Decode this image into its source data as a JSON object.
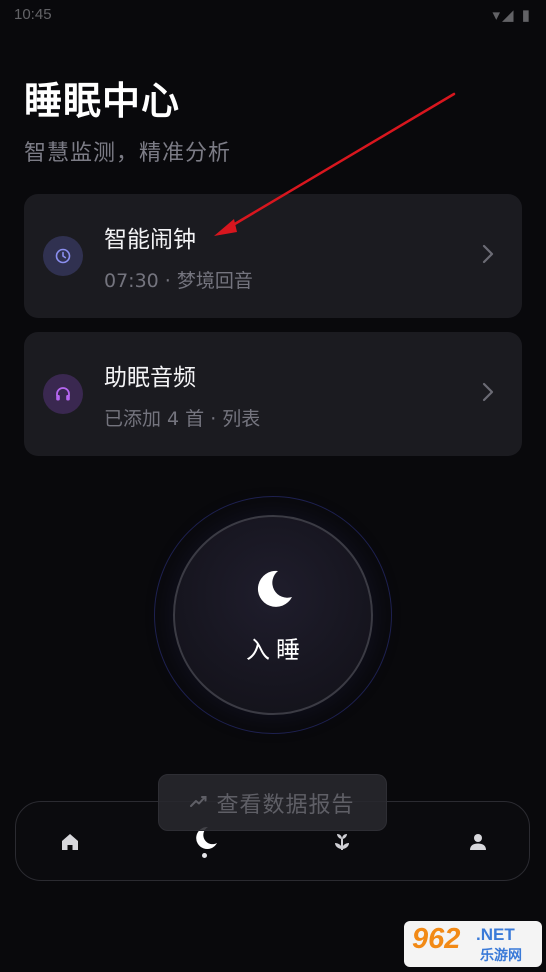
{
  "status_bar": {
    "time": "10:45",
    "right": "▾◢ ▮"
  },
  "header": {
    "title": "睡眠中心",
    "subtitle": "智慧监测，精准分析"
  },
  "cards": [
    {
      "title": "智能闹钟",
      "subtitle": "07:30 · 梦境回音",
      "icon": "clock-icon",
      "accent": "#8b8ff0"
    },
    {
      "title": "助眠音频",
      "subtitle": "已添加 4 首 · 列表",
      "icon": "headphones-icon",
      "accent": "#b566f0"
    }
  ],
  "sleep_button": {
    "label": "入睡",
    "icon": "moon-icon"
  },
  "report_button": {
    "label": "查看数据报告",
    "icon": "trend-icon"
  },
  "bottom_nav": {
    "items": [
      {
        "name": "home",
        "icon": "home-icon"
      },
      {
        "name": "sleep",
        "icon": "moon-icon",
        "active": true
      },
      {
        "name": "plant",
        "icon": "sprout-icon"
      },
      {
        "name": "profile",
        "icon": "user-icon"
      }
    ]
  },
  "watermark": {
    "num": "962",
    "net": ".NET",
    "cn": "乐游网"
  },
  "colors": {
    "background": "#09090c",
    "card": "#1b1b20",
    "annotation": "#d8161e"
  }
}
